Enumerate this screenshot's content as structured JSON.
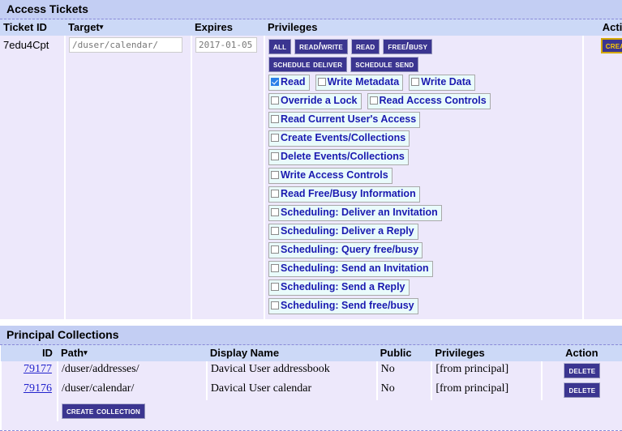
{
  "access_tickets": {
    "title": "Access Tickets",
    "columns": {
      "ticket_id": "Ticket ID",
      "target": "Target",
      "expires": "Expires",
      "privileges": "Privileges",
      "action": "Action"
    },
    "sort_indicator": "▾",
    "row": {
      "ticket_id": "7edu4Cpt",
      "target_value": "/duser/calendar/",
      "expires_value": "2017-01-05",
      "action_label": "Create"
    },
    "preset_buttons": [
      {
        "label": "All",
        "name": "all"
      },
      {
        "label": "Read/Write",
        "name": "read-write"
      },
      {
        "label": "Read",
        "name": "read"
      },
      {
        "label": "Free/Busy",
        "name": "free-busy"
      },
      {
        "label": "Schedule Deliver",
        "name": "schedule-deliver"
      },
      {
        "label": "Schedule Send",
        "name": "schedule-send"
      }
    ],
    "privilege_rows": [
      [
        {
          "label": "Read",
          "checked": true
        },
        {
          "label": "Write Metadata",
          "checked": false
        },
        {
          "label": "Write Data",
          "checked": false
        }
      ],
      [
        {
          "label": "Override a Lock",
          "checked": false
        },
        {
          "label": "Read Access Controls",
          "checked": false
        }
      ],
      [
        {
          "label": "Read Current User's Access",
          "checked": false
        }
      ],
      [
        {
          "label": "Create Events/Collections",
          "checked": false
        }
      ],
      [
        {
          "label": "Delete Events/Collections",
          "checked": false
        }
      ],
      [
        {
          "label": "Write Access Controls",
          "checked": false
        }
      ],
      [
        {
          "label": "Read Free/Busy Information",
          "checked": false
        }
      ],
      [
        {
          "label": "Scheduling: Deliver an Invitation",
          "checked": false
        }
      ],
      [
        {
          "label": "Scheduling: Deliver a Reply",
          "checked": false
        }
      ],
      [
        {
          "label": "Scheduling: Query free/busy",
          "checked": false
        }
      ],
      [
        {
          "label": "Scheduling: Send an Invitation",
          "checked": false
        }
      ],
      [
        {
          "label": "Scheduling: Send a Reply",
          "checked": false
        }
      ],
      [
        {
          "label": "Scheduling: Send free/busy",
          "checked": false
        }
      ]
    ]
  },
  "principal_collections": {
    "title": "Principal Collections",
    "columns": {
      "id": "ID",
      "path": "Path",
      "display_name": "Display Name",
      "public": "Public",
      "privileges": "Privileges",
      "action": "Action"
    },
    "sort_indicator": "▾",
    "rows": [
      {
        "id": "79177",
        "path": "/duser/addresses/",
        "display_name": "Davical User addressbook",
        "public": "No",
        "privileges": "[from principal]",
        "action_label": "Delete"
      },
      {
        "id": "79176",
        "path": "/duser/calendar/",
        "display_name": "Davical User calendar",
        "public": "No",
        "privileges": "[from principal]",
        "action_label": "Delete"
      }
    ],
    "create_collection_label": "Create Collection"
  },
  "colors": {
    "section_header_bg": "#c3cef3",
    "column_header_bg": "#ccd9f7",
    "row_bg": "#ede8fb",
    "button_navy": "#3b3590",
    "create_gold": "#ffcc00",
    "chip_bg": "#e9fbfb",
    "chip_text": "#1a1ab0",
    "link_blue": "#2222cc"
  }
}
